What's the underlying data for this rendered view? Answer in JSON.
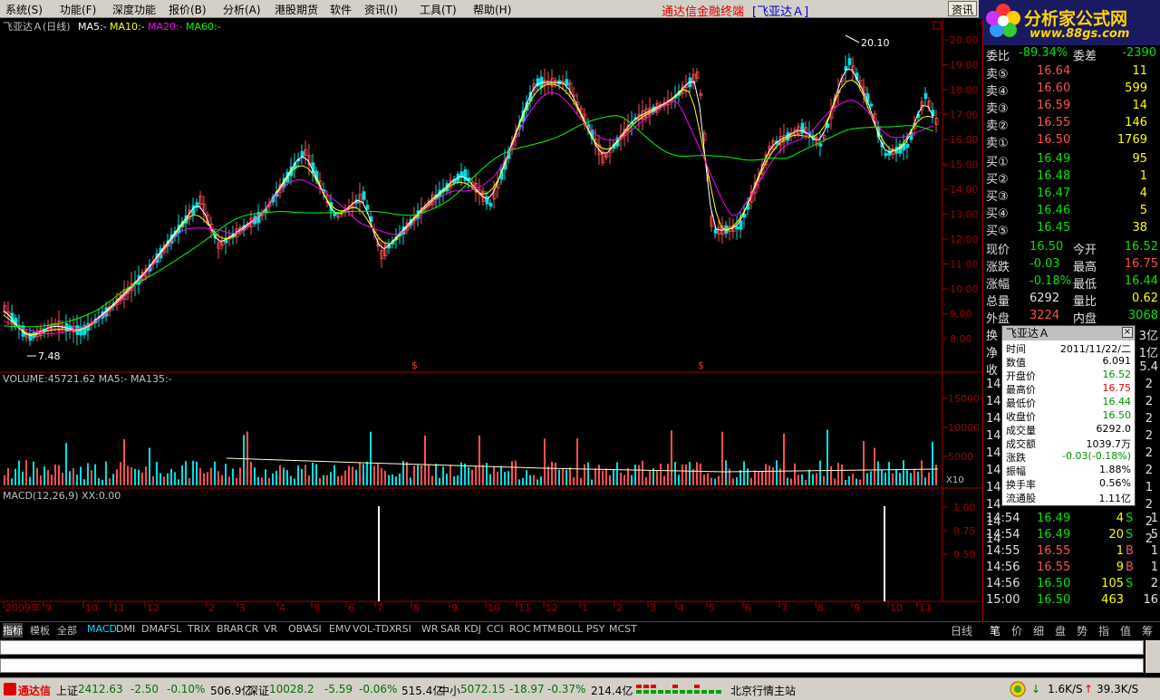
{
  "menu": {
    "items": [
      "系统(S)",
      "功能(F)",
      "深度功能",
      "报价(B)",
      "分析(A)",
      "港股期货",
      "软件",
      "资讯(I)",
      "工具(T)",
      "帮助(H)"
    ],
    "app_title": "通达信金融终端",
    "stock_title": "[飞亚达Ａ]",
    "info_button": "资讯"
  },
  "logo": {
    "text": "分析家公式网",
    "url": "www.88gs.com"
  },
  "kline": {
    "header": {
      "name": "飞亚达Ａ(日线)",
      "ma5": "MA5:-",
      "ma10": "MA10:-",
      "ma20": "MA20:-",
      "ma60": "MA60:-"
    },
    "high_label": "20.10",
    "low_label": "7.48",
    "marker": "$",
    "y_ticks": [
      "20.00",
      "19.00",
      "18.00",
      "17.00",
      "16.00",
      "15.00",
      "14.00",
      "13.00",
      "12.00",
      "11.00",
      "10.00",
      "9.00",
      "8.00"
    ]
  },
  "volume": {
    "header": "VOLUME:45721.62  MA5:-  MA135:-",
    "y_ticks": [
      "15000",
      "10000",
      "5000"
    ],
    "unit": "X10"
  },
  "macd": {
    "header": "MACD(12,26,9)  XX:0.00",
    "y_ticks": [
      "1.00",
      "0.75",
      "0.50"
    ]
  },
  "time_axis": {
    "labels": [
      "2009年",
      "9",
      "10",
      "11",
      "12",
      "2",
      "3",
      "4",
      "5",
      "6",
      "7",
      "8",
      "9",
      "10",
      "11",
      "12",
      "1",
      "2",
      "3",
      "4",
      "5",
      "6",
      "7",
      "8",
      "9",
      "10",
      "11"
    ]
  },
  "quote": {
    "top": {
      "label1": "委比",
      "val1": "-89.34%",
      "label2": "委差",
      "val2": "-2390"
    },
    "asks": [
      {
        "label": "卖⑤",
        "price": "16.64",
        "vol": "11"
      },
      {
        "label": "卖④",
        "price": "16.60",
        "vol": "599"
      },
      {
        "label": "卖③",
        "price": "16.59",
        "vol": "14"
      },
      {
        "label": "卖②",
        "price": "16.55",
        "vol": "146"
      },
      {
        "label": "卖①",
        "price": "16.50",
        "vol": "1769"
      }
    ],
    "bids": [
      {
        "label": "买①",
        "price": "16.49",
        "vol": "95"
      },
      {
        "label": "买②",
        "price": "16.48",
        "vol": "1"
      },
      {
        "label": "买③",
        "price": "16.47",
        "vol": "4"
      },
      {
        "label": "买④",
        "price": "16.46",
        "vol": "5"
      },
      {
        "label": "买⑤",
        "price": "16.45",
        "vol": "38"
      }
    ],
    "stats": [
      {
        "l1": "现价",
        "v1": "16.50",
        "c1": "dn",
        "l2": "今开",
        "v2": "16.52",
        "c2": "dn"
      },
      {
        "l1": "涨跌",
        "v1": "-0.03",
        "c1": "dn",
        "l2": "最高",
        "v2": "16.75",
        "c2": "up"
      },
      {
        "l1": "涨幅",
        "v1": "-0.18%",
        "c1": "dn",
        "l2": "最低",
        "v2": "16.44",
        "c2": "dn"
      },
      {
        "l1": "总量",
        "v1": "6292",
        "c1": "wh",
        "l2": "量比",
        "v2": "0.62",
        "c2": "yl"
      },
      {
        "l1": "外盘",
        "v1": "3224",
        "c1": "up",
        "l2": "内盘",
        "v2": "3068",
        "c2": "dn"
      }
    ],
    "partial_rows": [
      {
        "label": "换",
        "val": "3亿"
      },
      {
        "label": "净",
        "val": "1亿"
      },
      {
        "label": "收",
        "val": "5.4"
      }
    ],
    "hidden_ticks": [
      "14",
      "14",
      "14",
      "14",
      "14",
      "14",
      "14",
      "14",
      "14",
      "14"
    ],
    "hidden_tick_tail": [
      "2",
      "2",
      "2",
      "2",
      "2",
      "2",
      "1",
      "2",
      "2",
      "2"
    ],
    "ticks": [
      {
        "time": "14:54",
        "price": "16.49",
        "pc": "dn",
        "vol": "4",
        "side": "S",
        "n": "1"
      },
      {
        "time": "14:54",
        "price": "16.49",
        "pc": "dn",
        "vol": "20",
        "side": "S",
        "n": "5"
      },
      {
        "time": "14:55",
        "price": "16.55",
        "pc": "up",
        "vol": "1",
        "side": "B",
        "n": "1"
      },
      {
        "time": "14:56",
        "price": "16.55",
        "pc": "up",
        "vol": "9",
        "side": "B",
        "n": "1"
      },
      {
        "time": "14:56",
        "price": "16.50",
        "pc": "dn",
        "vol": "105",
        "side": "S",
        "n": "2"
      },
      {
        "time": "15:00",
        "price": "16.50",
        "pc": "dn",
        "vol": "463",
        "side": "",
        "n": "16"
      }
    ]
  },
  "popup": {
    "title": "飞亚达Ａ",
    "rows": [
      {
        "label": "时间",
        "value": "2011/11/22/二",
        "c": ""
      },
      {
        "label": "数值",
        "value": "6.091",
        "c": ""
      },
      {
        "label": "开盘价",
        "value": "16.52",
        "c": "dn"
      },
      {
        "label": "最高价",
        "value": "16.75",
        "c": "up"
      },
      {
        "label": "最低价",
        "value": "16.44",
        "c": "dn"
      },
      {
        "label": "收盘价",
        "value": "16.50",
        "c": "dn"
      },
      {
        "label": "成交量",
        "value": "6292.0",
        "c": ""
      },
      {
        "label": "成交额",
        "value": "1039.7万",
        "c": ""
      },
      {
        "label": "涨跌",
        "value": "-0.03(-0.18%)",
        "c": "dn"
      },
      {
        "label": "振幅",
        "value": "1.88%",
        "c": ""
      },
      {
        "label": "换手率",
        "value": "0.56%",
        "c": ""
      },
      {
        "label": "流通股",
        "value": "1.11亿",
        "c": ""
      }
    ]
  },
  "tabs": [
    "指标",
    "模板",
    "全部",
    "MACD",
    "DMI",
    "DMA",
    "FSL",
    "TRIX",
    "BRAR",
    "CR",
    "VR",
    "OBV",
    "ASI",
    "EMV",
    "VOL-TDX",
    "RSI",
    "WR",
    "SAR",
    "KDJ",
    "CCI",
    "ROC",
    "MTM",
    "BOLL",
    "PSY",
    "MCST"
  ],
  "day_tab": "日线",
  "right_tabs": [
    "笔",
    "价",
    "细",
    "盘",
    "势",
    "指",
    "值",
    "筹"
  ],
  "status": {
    "brand": "通达信",
    "sh_label": "上证",
    "sh_val": "2412.63",
    "sh_chg": "-2.50",
    "sh_pct": "-0.10%",
    "sh_amt": "506.9亿",
    "sz_label": "深证",
    "sz_val": "10028.2",
    "sz_chg": "-5.59",
    "sz_pct": "-0.06%",
    "sz_amt": "515.4亿",
    "zx_label": "中小",
    "zx_val": "5072.15",
    "zx_chg": "-18.97",
    "zx_pct": "-0.37%",
    "zx_amt": "214.4亿",
    "station": "北京行情主站",
    "down_rate": "1.6K/S",
    "up_rate": "39.3K/S"
  },
  "colors": {
    "up": "#ff5050",
    "down": "#00e600",
    "ma5": "#ffffff",
    "ma10": "#ffff00",
    "ma20": "#ff00ff",
    "ma60": "#00ff00"
  }
}
